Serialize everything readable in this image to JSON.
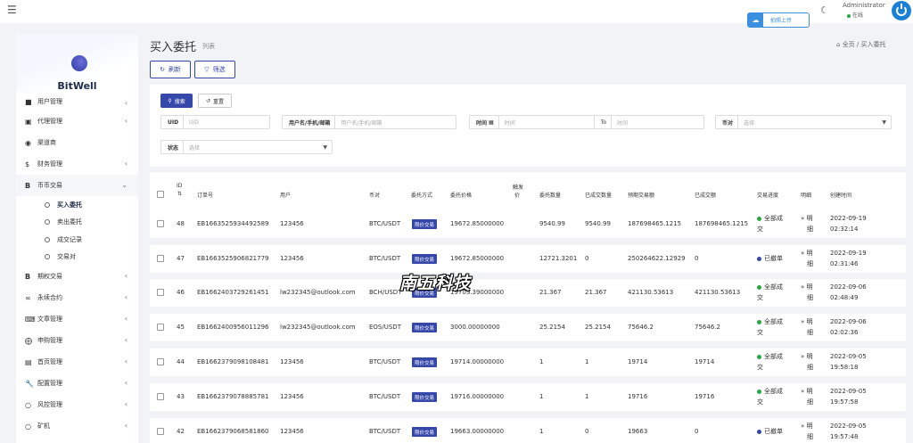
{
  "topbar": {
    "upload_label": "拍照上传",
    "admin_name": "Administrator",
    "admin_status": "在线"
  },
  "sidebar": {
    "brand": "BitWell",
    "items": [
      {
        "label": "用户管理",
        "icon": "users-icon",
        "chevron": true
      },
      {
        "label": "代理管理",
        "icon": "id-card-icon",
        "chevron": true
      },
      {
        "label": "渠道商",
        "icon": "user-circle-icon",
        "chevron": false
      },
      {
        "label": "财务管理",
        "icon": "dollar-icon",
        "chevron": true
      },
      {
        "label": "币币交易",
        "icon": "bitcoin-icon",
        "chevron": true,
        "expanded": true
      },
      {
        "label": "期权交易",
        "icon": "bitcoin-icon",
        "chevron": true
      },
      {
        "label": "永续合约",
        "icon": "link-icon",
        "chevron": true
      },
      {
        "label": "文章管理",
        "icon": "keyboard-icon",
        "chevron": true
      },
      {
        "label": "申购管理",
        "icon": "life-ring-icon",
        "chevron": true
      },
      {
        "label": "首页管理",
        "icon": "list-icon",
        "chevron": true
      },
      {
        "label": "配置管理",
        "icon": "wrench-icon",
        "chevron": true
      },
      {
        "label": "风控管理",
        "icon": "circle-icon",
        "chevron": true
      },
      {
        "label": "矿机",
        "icon": "circle-icon",
        "chevron": true
      }
    ],
    "subitems": [
      {
        "label": "买入委托",
        "active": true
      },
      {
        "label": "卖出委托",
        "active": false
      },
      {
        "label": "成交记录",
        "active": false
      },
      {
        "label": "交易对",
        "active": false
      }
    ]
  },
  "header": {
    "title": "买入委托",
    "subtitle": "列表",
    "breadcrumb_home": "全页",
    "breadcrumb_sep": "/",
    "breadcrumb_current": "买入委托",
    "refresh_label": "刷新",
    "filter_label": "筛选"
  },
  "filters": {
    "search_label": "搜索",
    "reset_label": "重置",
    "uid_label": "UID",
    "uid_placeholder": "UID",
    "user_label": "用户名/手机/邮箱",
    "user_placeholder": "用户名/手机/邮箱",
    "time_label": "时间",
    "time_from_placeholder": "时间",
    "time_to_label": "To",
    "time_to_placeholder": "时间",
    "pair_label": "币对",
    "pair_placeholder": "选择",
    "status_label": "状态",
    "status_placeholder": "选择"
  },
  "table": {
    "columns": {
      "id": "ID",
      "order_no": "订单号",
      "user": "用户",
      "pair": "币对",
      "method": "委托方式",
      "price": "委托价格",
      "trigger_line1": "触发",
      "trigger_line2": "价",
      "qty": "委托数量",
      "filled": "已成交数量",
      "expected": "预期交易额",
      "done_amount": "已成交额",
      "progress": "交易进度",
      "detail": "明细",
      "created": "创建时间"
    },
    "rows": [
      {
        "id": "48",
        "order_no": "EB1663525934492589",
        "user": "123456",
        "pair": "BTC/USDT",
        "method": "限价交易",
        "price": "19672.85000000",
        "qty": "9540.99",
        "filled": "9540.99",
        "expected": "187698465.1215",
        "done_amount": "187698465.1215",
        "status_l1": "全部成",
        "status_l2": "交",
        "status_color": "#28a745",
        "detail_l1": "» 明",
        "detail_l2": "细",
        "date": "2022-09-19",
        "time": "02:32:14"
      },
      {
        "id": "47",
        "order_no": "EB1663525906821779",
        "user": "123456",
        "pair": "BTC/USDT",
        "method": "限价交易",
        "price": "19672.85000000",
        "qty": "12721.3201",
        "filled": "0",
        "expected": "250264622.12929",
        "done_amount": "0",
        "status_l1": "已撤单",
        "status_l2": "",
        "status_color": "#3547a8",
        "detail_l1": "» 明",
        "detail_l2": "细",
        "date": "2022-09-19",
        "time": "02:31:46"
      },
      {
        "id": "46",
        "order_no": "EB1662403729261451",
        "user": "lw232345@outlook.com",
        "pair": "BCH/USDT",
        "method": "限价交易",
        "price": "19709.39000000",
        "qty": "21.367",
        "filled": "21.367",
        "expected": "421130.53613",
        "done_amount": "421130.53613",
        "status_l1": "全部成",
        "status_l2": "交",
        "status_color": "#28a745",
        "detail_l1": "» 明",
        "detail_l2": "细",
        "date": "2022-09-06",
        "time": "02:48:49"
      },
      {
        "id": "45",
        "order_no": "EB1662400956011296",
        "user": "lw232345@outlook.com",
        "pair": "EOS/USDT",
        "method": "限价交易",
        "price": "3000.00000000",
        "qty": "25.2154",
        "filled": "25.2154",
        "expected": "75646.2",
        "done_amount": "75646.2",
        "status_l1": "全部成",
        "status_l2": "交",
        "status_color": "#28a745",
        "detail_l1": "» 明",
        "detail_l2": "细",
        "date": "2022-09-06",
        "time": "02:02:36"
      },
      {
        "id": "44",
        "order_no": "EB1662379098108481",
        "user": "123456",
        "pair": "BTC/USDT",
        "method": "限价交易",
        "price": "19714.00000000",
        "qty": "1",
        "filled": "1",
        "expected": "19714",
        "done_amount": "19714",
        "status_l1": "全部成",
        "status_l2": "交",
        "status_color": "#28a745",
        "detail_l1": "» 明",
        "detail_l2": "细",
        "date": "2022-09-05",
        "time": "19:58:18"
      },
      {
        "id": "43",
        "order_no": "EB1662379078885781",
        "user": "123456",
        "pair": "BTC/USDT",
        "method": "限价交易",
        "price": "19716.00000000",
        "qty": "1",
        "filled": "1",
        "expected": "19716",
        "done_amount": "19716",
        "status_l1": "全部成",
        "status_l2": "交",
        "status_color": "#28a745",
        "detail_l1": "» 明",
        "detail_l2": "细",
        "date": "2022-09-05",
        "time": "19:57:58"
      },
      {
        "id": "42",
        "order_no": "EB1662379068581860",
        "user": "123456",
        "pair": "BTC/USDT",
        "method": "限价交易",
        "price": "19663.00000000",
        "qty": "1",
        "filled": "0",
        "expected": "19663",
        "done_amount": "0",
        "status_l1": "已撤单",
        "status_l2": "",
        "status_color": "#3547a8",
        "detail_l1": "» 明",
        "detail_l2": "细",
        "date": "2022-09-05",
        "time": "19:57:48"
      }
    ]
  },
  "watermark": "南五科技"
}
